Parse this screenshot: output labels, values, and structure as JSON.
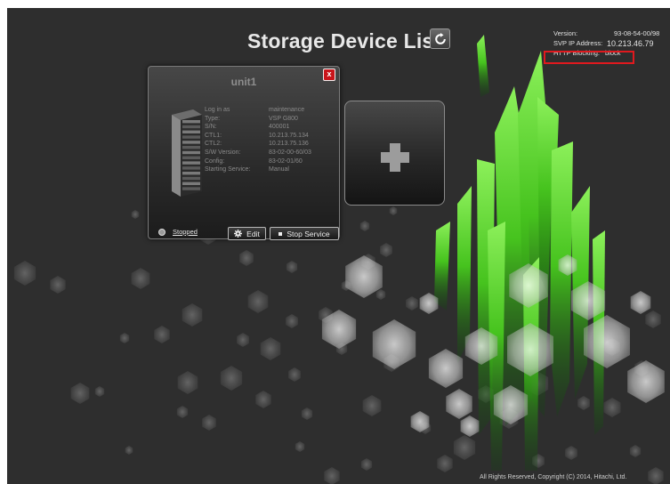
{
  "header": {
    "title": "Storage Device List"
  },
  "info": {
    "version_label": "Version:",
    "version_value": "93-08-54-00/98",
    "svp_label": "SVP IP Address:",
    "svp_value": "10.213.46.79",
    "http_label": "HTTP Blocking:",
    "http_value": "block"
  },
  "unit": {
    "name": "unit1",
    "details": [
      {
        "label": "Log in as",
        "value": "maintenance"
      },
      {
        "label": "Type:",
        "value": "VSP G800"
      },
      {
        "label": "S/N:",
        "value": "400001"
      },
      {
        "label": "CTL1:",
        "value": "10.213.75.134"
      },
      {
        "label": "CTL2:",
        "value": "10.213.75.136"
      },
      {
        "label": "S/W Version:",
        "value": "83-02-00-60/03"
      },
      {
        "label": "Config:",
        "value": "83-02-01/60"
      },
      {
        "label": "Starting Service:",
        "value": "Manual"
      }
    ],
    "status": "Stopped",
    "edit_label": "Edit",
    "stop_label": "Stop Service",
    "close_glyph": "x"
  },
  "add_tile": {
    "glyph": "+"
  },
  "footer": {
    "copyright": "All Rights Reserved, Copyright (C) 2014, Hitachi, Ltd."
  },
  "colors": {
    "accent_red": "#e0191e",
    "accent_green": "#5ed62a",
    "background": "#2e2e2e"
  },
  "icons": [
    "refresh-icon",
    "close-icon",
    "server-rack-icon",
    "status-indicator-icon",
    "gear-icon",
    "stop-icon",
    "plus-icon"
  ]
}
